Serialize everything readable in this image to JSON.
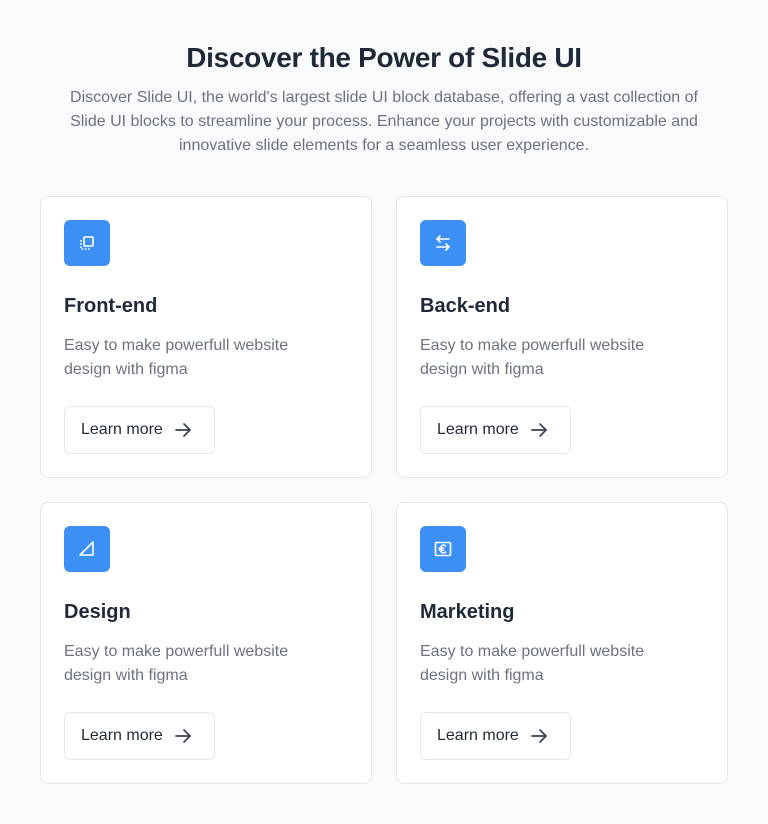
{
  "header": {
    "title": "Discover the Power of Slide UI",
    "subtitle": "Discover Slide UI, the world's largest slide UI block database, offering a vast collection of Slide UI blocks to streamline your process. Enhance your projects with customizable and innovative slide elements for a seamless user experience."
  },
  "colors": {
    "accent": "#3b8ff5",
    "background": "#f9fafb",
    "card_border": "#e5e7eb",
    "text_primary": "#1f2937",
    "text_secondary": "#6b7280"
  },
  "cards": [
    {
      "icon": "copy-icon",
      "title": "Front-end",
      "description": "Easy to make powerfull website design with figma",
      "button_label": "Learn more",
      "button_icon": "arrow-right-icon"
    },
    {
      "icon": "arrows-swap-icon",
      "title": "Back-end",
      "description": "Easy to make powerfull website design with figma",
      "button_label": "Learn more",
      "button_icon": "arrow-right-icon"
    },
    {
      "icon": "triangle-ruler-icon",
      "title": "Design",
      "description": "Easy to make powerfull website design with figma",
      "button_label": "Learn more",
      "button_icon": "arrow-right-icon"
    },
    {
      "icon": "euro-card-icon",
      "title": "Marketing",
      "description": "Easy to make powerfull website design with figma",
      "button_label": "Learn more",
      "button_icon": "arrow-right-icon"
    }
  ]
}
